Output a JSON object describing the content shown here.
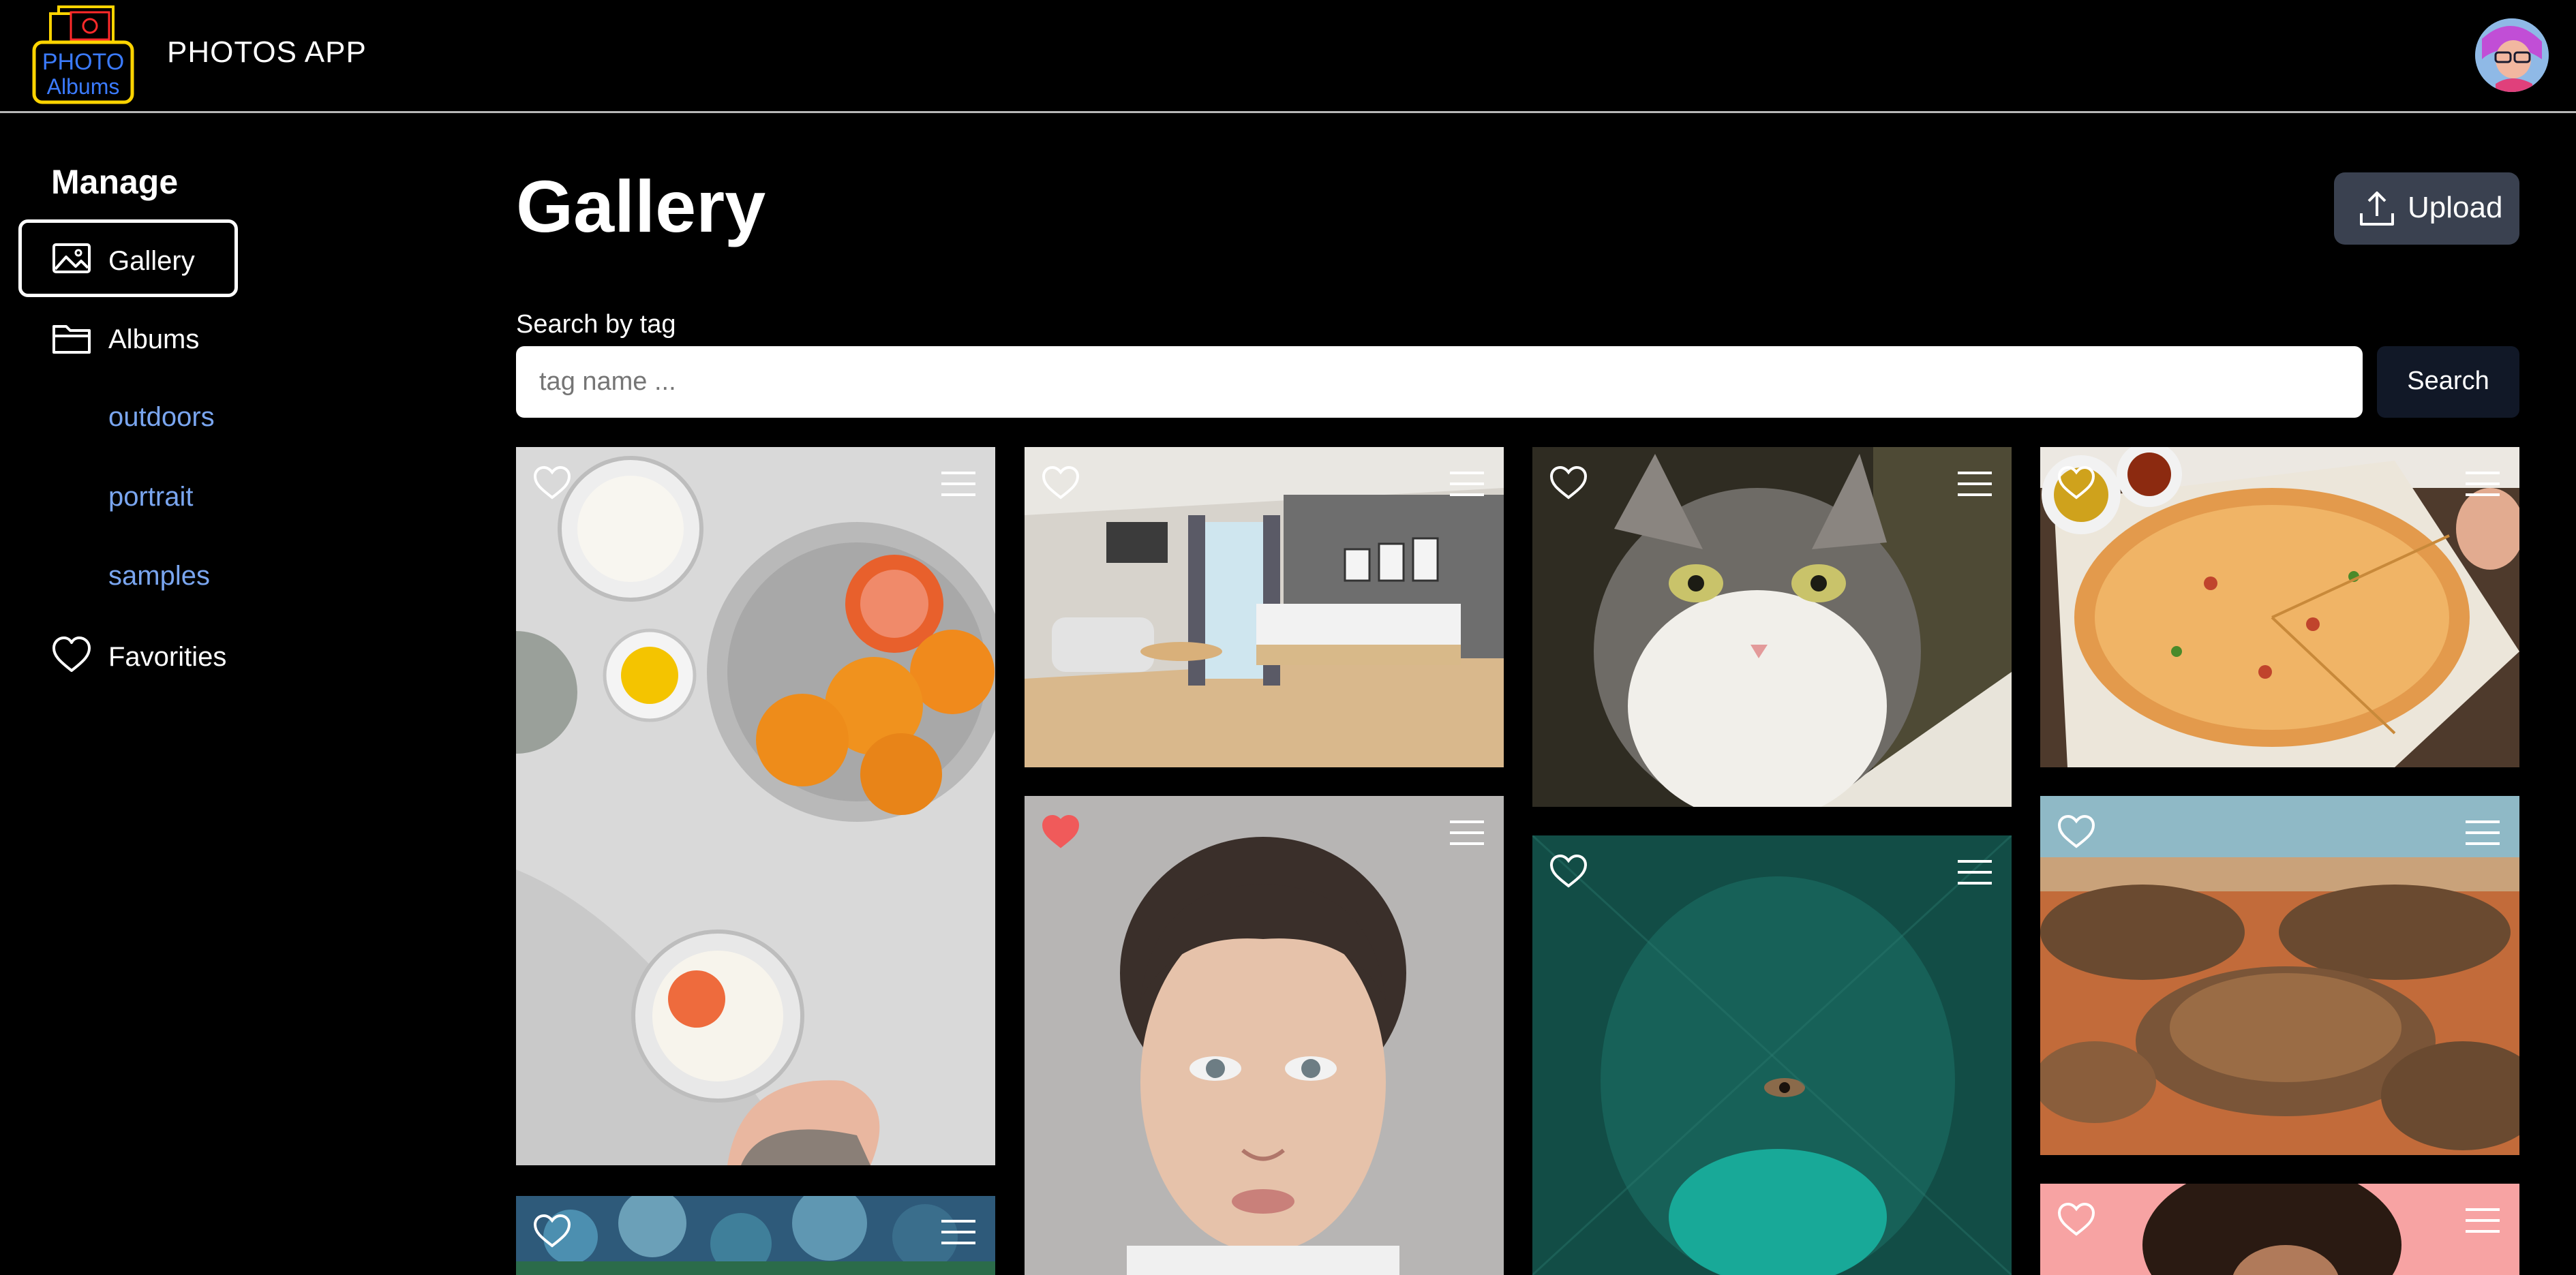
{
  "header": {
    "app_title": "PHOTOS APP",
    "logo_alt": "PHOTO Albums"
  },
  "sidebar": {
    "heading": "Manage",
    "items": [
      {
        "label": "Gallery",
        "icon": "image-icon",
        "active": true
      },
      {
        "label": "Albums",
        "icon": "folder-icon",
        "active": false
      },
      {
        "label": "Favorities",
        "icon": "heart-icon",
        "active": false
      }
    ],
    "albums": [
      {
        "label": "outdoors"
      },
      {
        "label": "portrait"
      },
      {
        "label": "samples"
      }
    ]
  },
  "main": {
    "title": "Gallery",
    "upload_label": "Upload",
    "search": {
      "label": "Search by tag",
      "placeholder": "tag name ...",
      "value": "",
      "button_label": "Search"
    }
  },
  "photos": [
    {
      "subject": "food-bowls-oranges",
      "favorite": false
    },
    {
      "subject": "bedroom-interior",
      "favorite": false
    },
    {
      "subject": "kitten",
      "favorite": false
    },
    {
      "subject": "pizza",
      "favorite": false
    },
    {
      "subject": "woman-portrait",
      "favorite": true
    },
    {
      "subject": "face-behind-bubble-wrap",
      "favorite": false
    },
    {
      "subject": "desert-rocks",
      "favorite": false
    },
    {
      "subject": "bokeh-lights",
      "favorite": false
    },
    {
      "subject": "curly-hair-pink",
      "favorite": false
    }
  ],
  "colors": {
    "background": "#000000",
    "album_link": "#7aa6f0",
    "upload_button": "#3a4150",
    "search_button": "#111827",
    "favorite_heart": "#f05a5a"
  }
}
